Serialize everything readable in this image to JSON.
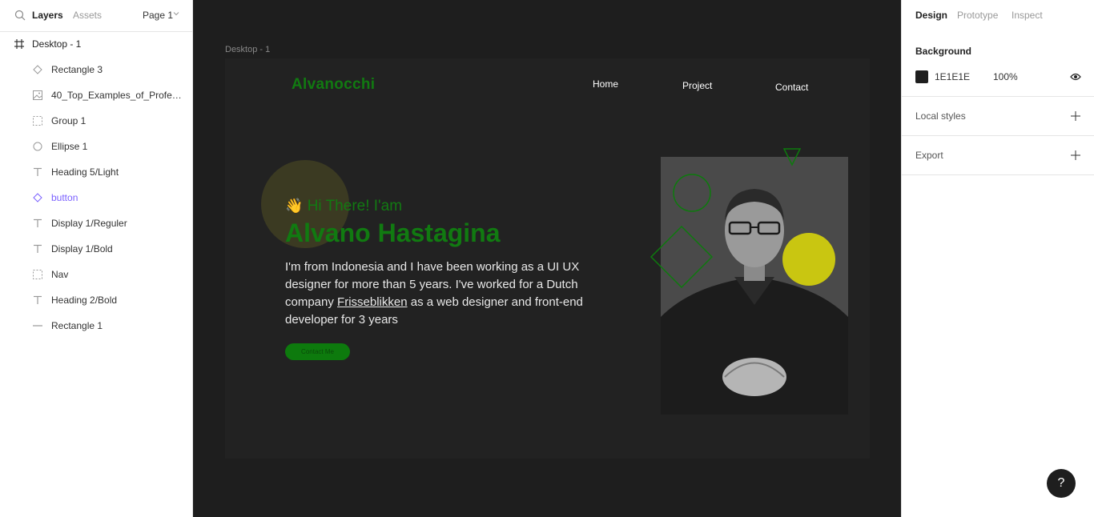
{
  "left_panel": {
    "tab_layers": "Layers",
    "tab_assets": "Assets",
    "page": "Page 1",
    "root_layer": "Desktop - 1",
    "layers": [
      {
        "label": "Rectangle 3",
        "icon": "diamond-icon"
      },
      {
        "label": "40_Top_Examples_of_Professi...",
        "icon": "image-icon"
      },
      {
        "label": "Group 1",
        "icon": "group-icon"
      },
      {
        "label": "Ellipse 1",
        "icon": "ellipse-icon"
      },
      {
        "label": "Heading 5/Light",
        "icon": "text-icon"
      },
      {
        "label": "button",
        "icon": "component-icon"
      },
      {
        "label": "Display 1/Reguler",
        "icon": "text-icon"
      },
      {
        "label": "Display 1/Bold",
        "icon": "text-icon"
      },
      {
        "label": "Nav",
        "icon": "group-icon"
      },
      {
        "label": "Heading 2/Bold",
        "icon": "text-icon"
      },
      {
        "label": "Rectangle 1",
        "icon": "line-icon"
      }
    ]
  },
  "canvas": {
    "frame_label": "Desktop - 1",
    "logo": "Alvanocchi",
    "nav": [
      "Home",
      "Project",
      "Contact"
    ],
    "greeting_emoji": "👋",
    "greeting": "Hi There! I'am",
    "name": "Alvano Hastagina",
    "bio_before": "I'm from Indonesia and I have been working as a UI UX designer for more than 5 years. I've worked for a Dutch company ",
    "bio_link": "Frisseblikken",
    "bio_after": " as a web designer and front-end developer for 3 years",
    "cta": "Contact Me"
  },
  "right_panel": {
    "tab_design": "Design",
    "tab_prototype": "Prototype",
    "tab_inspect": "Inspect",
    "background_title": "Background",
    "background_hex": "1E1E1E",
    "background_opacity": "100%",
    "local_styles": "Local styles",
    "export": "Export",
    "help": "?"
  },
  "colors": {
    "canvas_bg": "#1e1e1e",
    "frame_bg": "#222222",
    "brand_green": "#117a11",
    "component_purple": "#7b61ff",
    "accent_yellow": "#c9c611"
  }
}
